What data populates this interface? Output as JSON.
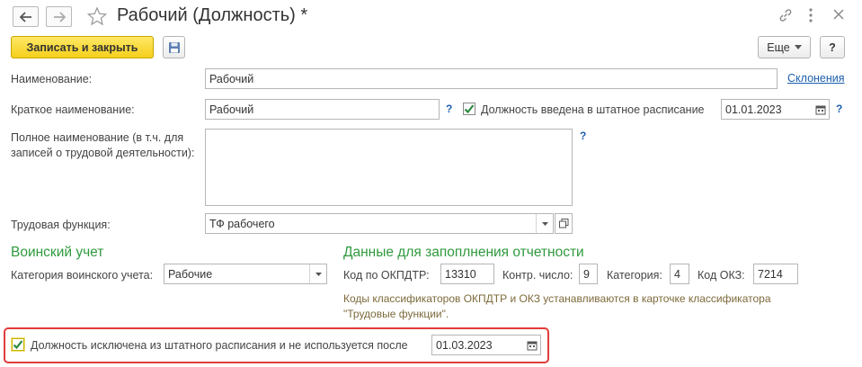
{
  "window": {
    "title": "Рабочий (Должность) *"
  },
  "toolbar": {
    "save_close_label": "Записать и закрыть",
    "more_label": "Еще",
    "help_label": "?"
  },
  "form": {
    "name_label": "Наименование:",
    "name_value": "Рабочий",
    "declensions_link": "Склонения",
    "short_name_label": "Краткое наименование:",
    "short_name_value": "Рабочий",
    "help_q": "?",
    "staffing_checkbox_label": "Должность введена в штатное расписание",
    "staffing_date": "01.01.2023",
    "full_name_label_line1": "Полное наименование (в т.ч. для",
    "full_name_label_line2": "записей о трудовой деятельности):",
    "full_name_value": "",
    "labor_function_label": "Трудовая функция:",
    "labor_function_value": "ТФ рабочего"
  },
  "military": {
    "title": "Воинский учет",
    "category_label": "Категория воинского учета:",
    "category_value": "Рабочие"
  },
  "reporting": {
    "title": "Данные для запоплнения отчетности",
    "okpdtr_label": "Код по ОКПДТР:",
    "okpdtr_value": "13310",
    "control_label": "Контр. число:",
    "control_value": "9",
    "category_label": "Категория:",
    "category_value": "4",
    "okz_label": "Код ОКЗ:",
    "okz_value": "7214",
    "note_line1": "Коды классификаторов ОКПДТР и ОКЗ устанавливаются в карточке классификатора",
    "note_line2": "\"Трудовые функции\"."
  },
  "excluded": {
    "checkbox_label": "Должность исключена из штатного расписания и не используется после",
    "date": "01.03.2023"
  },
  "colors": {
    "accent_green": "#2f9a3e",
    "highlight_red": "#e03c3c",
    "link_blue": "#1d5fae",
    "primary_yellow": "#f5cf1a"
  }
}
